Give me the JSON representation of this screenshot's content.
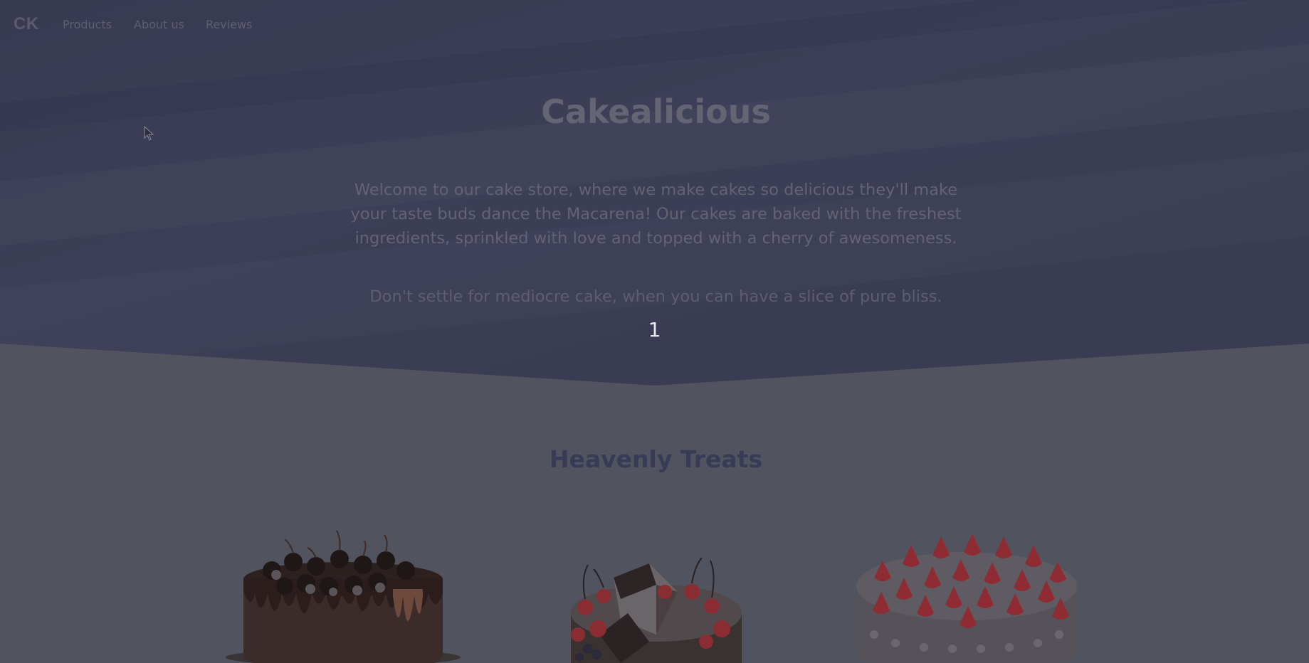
{
  "nav": {
    "logo": "CK",
    "links": [
      "Products",
      "About us",
      "Reviews"
    ]
  },
  "hero": {
    "title": "Cakealicious",
    "description": "Welcome to our cake store, where we make cakes so delicious they'll make your taste buds dance the Macarena! Our cakes are baked with the freshest ingredients, sprinkled with love and topped with a cherry of awesomeness.",
    "tagline": "Don't settle for mediocre cake, when you can have a slice of pure bliss.",
    "counter": "1"
  },
  "section": {
    "title": "Heavenly Treats"
  },
  "products": [
    {
      "image": "chocolate-drip-cake-image"
    },
    {
      "image": "black-forest-cake-image"
    },
    {
      "image": "strawberry-cream-cake-image"
    }
  ],
  "colors": {
    "hero_bg": "#3b3d55",
    "page_bg": "#51545f",
    "section_title": "#383b55",
    "counter_text": "#e8e8ee"
  }
}
